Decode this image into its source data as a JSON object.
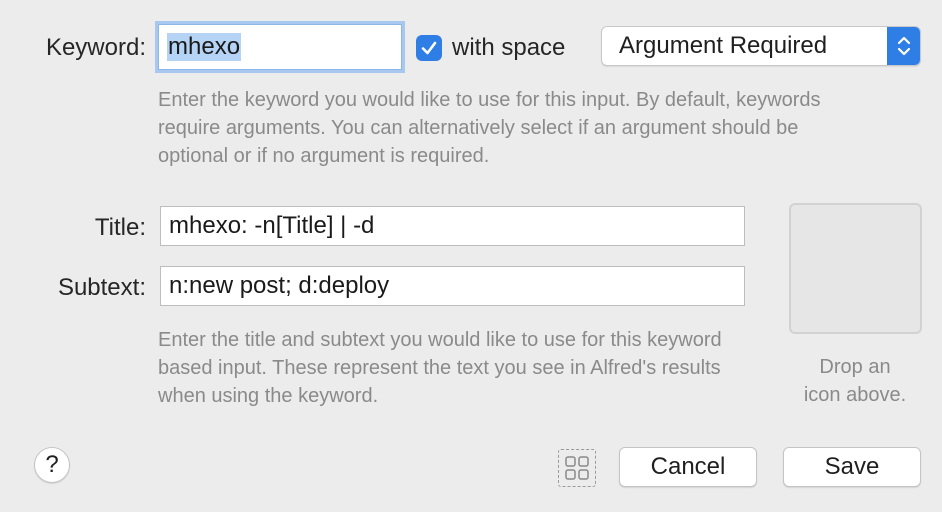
{
  "keyword": {
    "label": "Keyword:",
    "value": "mhexo",
    "with_space_label": "with space",
    "with_space_checked": true,
    "argument_select": "Argument Required",
    "help": "Enter the keyword you would like to use for this input. By default, keywords require arguments. You can alternatively select if an argument should be optional or if no argument is required."
  },
  "title": {
    "label": "Title:",
    "value": "mhexo: -n[Title] | -d"
  },
  "subtext": {
    "label": "Subtext:",
    "value": "n:new post; d:deploy",
    "help": "Enter the title and subtext you would like to use for this keyword based input. These represent the text you see in Alfred's results when using the keyword."
  },
  "icon_drop": {
    "caption_line1": "Drop an",
    "caption_line2": "icon above."
  },
  "footer": {
    "help_label": "?",
    "cancel_label": "Cancel",
    "save_label": "Save"
  },
  "colors": {
    "accent": "#2f7ee6",
    "background": "#ececec",
    "help_text": "#8a8a8a",
    "selection": "#b4d3f5"
  },
  "icons": [
    "checkmark-icon",
    "up-down-chevron-icon",
    "grid-icon"
  ]
}
